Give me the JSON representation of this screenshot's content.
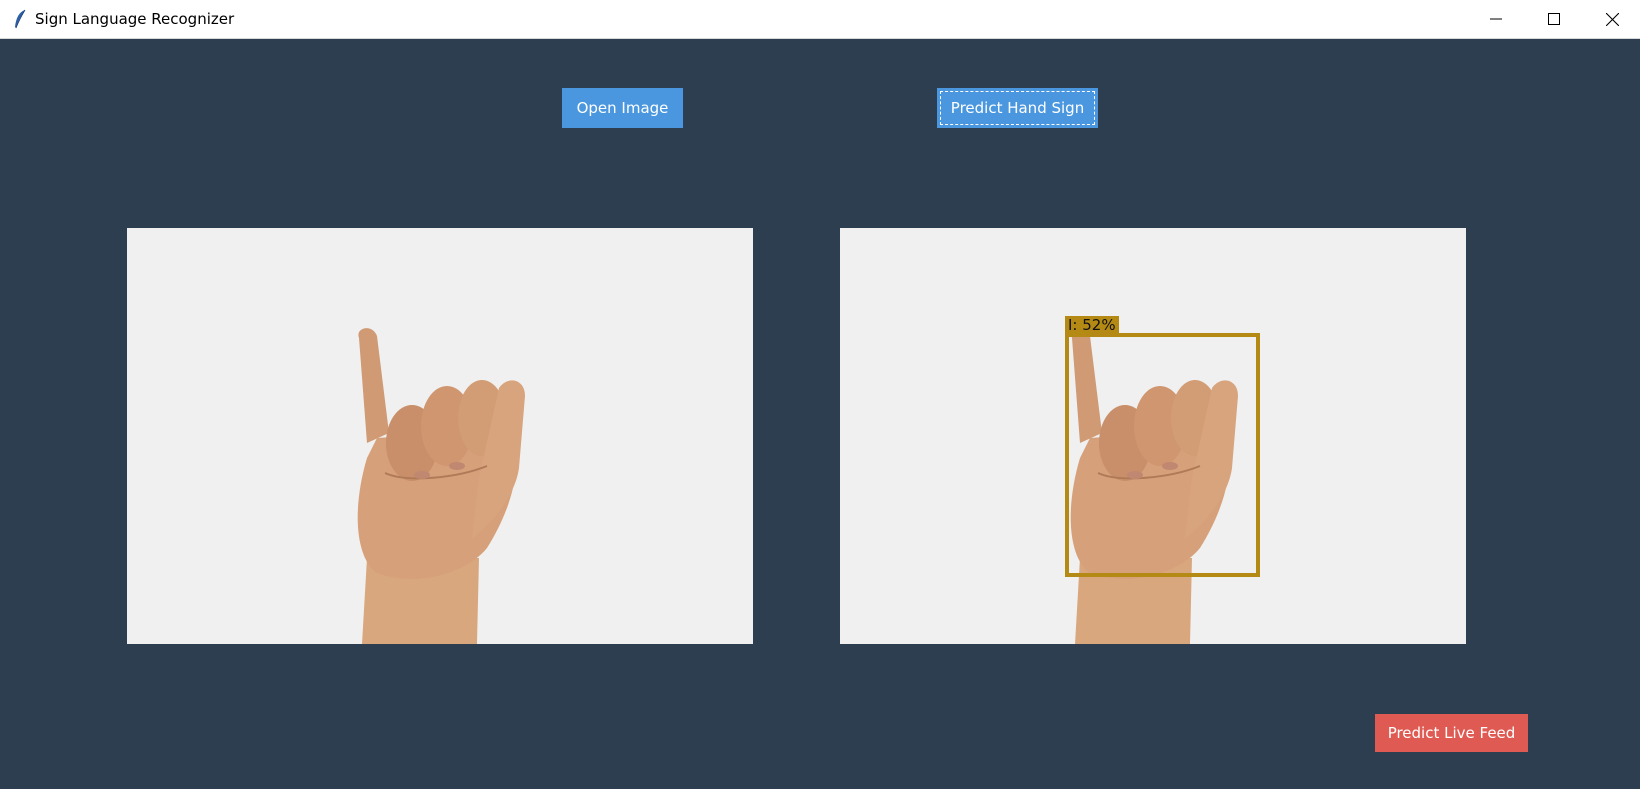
{
  "window": {
    "title": "Sign Language Recognizer",
    "app_icon": "feather-icon",
    "controls": [
      "minimize-icon",
      "maximize-icon",
      "close-icon"
    ]
  },
  "toolbar": {
    "open_image_label": "Open Image",
    "predict_hand_sign_label": "Predict Hand Sign"
  },
  "images": {
    "input_alt": "hand-sign-input-image",
    "output_alt": "hand-sign-prediction-image"
  },
  "prediction": {
    "label": "I: 52%",
    "letter": "I",
    "confidence_percent": 52
  },
  "footer": {
    "predict_live_feed_label": "Predict Live Feed"
  },
  "colors": {
    "background": "#2c3e50",
    "primary_button": "#4a97e0",
    "live_button": "#de5a52",
    "bbox": "#b58a14",
    "panel": "#f0f0f0"
  }
}
